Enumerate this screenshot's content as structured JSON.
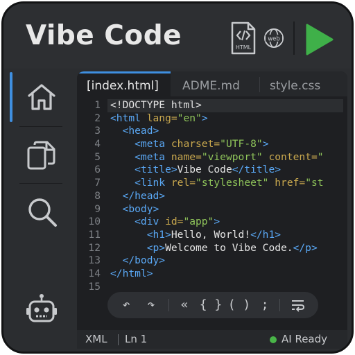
{
  "app": {
    "title": "Vibe Code"
  },
  "header": {
    "file_icon": "html-file-icon",
    "file_icon_label": "HTML",
    "web_icon": "globe-web-icon",
    "web_icon_label": "web",
    "run_icon": "play-icon"
  },
  "sidebar": {
    "items": [
      {
        "icon": "home-icon",
        "active": true
      },
      {
        "icon": "copy-files-icon",
        "active": false
      },
      {
        "icon": "search-icon",
        "active": false
      },
      {
        "icon": "robot-icon",
        "active": false
      }
    ]
  },
  "tabs": [
    {
      "label": "[index.html]",
      "active": true
    },
    {
      "label": "ADME.md",
      "active": false
    },
    {
      "label": "style.css",
      "active": false
    }
  ],
  "editor": {
    "current_line": 1,
    "lines": [
      {
        "n": "1",
        "tokens": [
          [
            "t-txt",
            "<!DOCTYPE html>"
          ]
        ]
      },
      {
        "n": "2",
        "tokens": [
          [
            "t-tag",
            "<html "
          ],
          [
            "t-attr",
            "lang="
          ],
          [
            "t-str",
            "\"en\""
          ],
          [
            "t-tag",
            ">"
          ]
        ]
      },
      {
        "n": "3",
        "tokens": [
          [
            "t-tag",
            "  <head>"
          ]
        ]
      },
      {
        "n": "4",
        "tokens": [
          [
            "t-tag",
            "    <meta "
          ],
          [
            "t-attr",
            "charset="
          ],
          [
            "t-str",
            "\"UTF-8\""
          ],
          [
            "t-tag",
            ">"
          ]
        ]
      },
      {
        "n": "5",
        "tokens": [
          [
            "t-tag",
            "    <meta "
          ],
          [
            "t-attr",
            "name="
          ],
          [
            "t-str",
            "\"viewport\""
          ],
          [
            "t-attr",
            " content="
          ],
          [
            "t-str",
            "\""
          ]
        ]
      },
      {
        "n": "6",
        "tokens": [
          [
            "t-tag",
            "    <title>"
          ],
          [
            "t-txt",
            "Vibe Code"
          ],
          [
            "t-tag",
            "</title>"
          ]
        ]
      },
      {
        "n": "7",
        "tokens": [
          [
            "t-tag",
            "    <link "
          ],
          [
            "t-attr",
            "rel="
          ],
          [
            "t-str",
            "\"stylesheet\""
          ],
          [
            "t-attr",
            " href="
          ],
          [
            "t-str",
            "\"st"
          ]
        ]
      },
      {
        "n": "8",
        "tokens": [
          [
            "t-tag",
            "  </head>"
          ]
        ]
      },
      {
        "n": "9",
        "tokens": [
          [
            "t-tag",
            "  <body>"
          ]
        ]
      },
      {
        "n": "10",
        "tokens": [
          [
            "t-tag",
            "    <div "
          ],
          [
            "t-attr",
            "id="
          ],
          [
            "t-str",
            "\"app\""
          ],
          [
            "t-tag",
            ">"
          ]
        ]
      },
      {
        "n": "11",
        "tokens": [
          [
            "t-tag",
            "      <h1>"
          ],
          [
            "t-txt",
            "Hello, World!"
          ],
          [
            "t-tag",
            "</h1>"
          ]
        ]
      },
      {
        "n": "12",
        "tokens": [
          [
            "t-tag",
            "      <p>"
          ],
          [
            "t-txt",
            "Welcome to Vibe Code."
          ],
          [
            "t-tag",
            "</p>"
          ]
        ]
      },
      {
        "n": "13",
        "tokens": [
          [
            "t-tag",
            "  </body>"
          ]
        ]
      },
      {
        "n": "14",
        "tokens": [
          [
            "t-tag",
            "</html>"
          ]
        ]
      },
      {
        "n": "15",
        "tokens": []
      }
    ]
  },
  "toolbar": {
    "undo": "↶",
    "redo": "↷",
    "back": "«",
    "braces": "{ }",
    "parens": "( )",
    "semicolon": ";",
    "wrap_icon": "word-wrap-icon"
  },
  "status": {
    "language": "XML",
    "position": "Ln 1",
    "ai_status": "AI Ready",
    "ai_color": "#49b548"
  },
  "colors": {
    "accent": "#3f8fe0",
    "run": "#3fb049",
    "tag": "#5aa8f5",
    "attr": "#c9a84e",
    "string": "#8fc45a"
  }
}
